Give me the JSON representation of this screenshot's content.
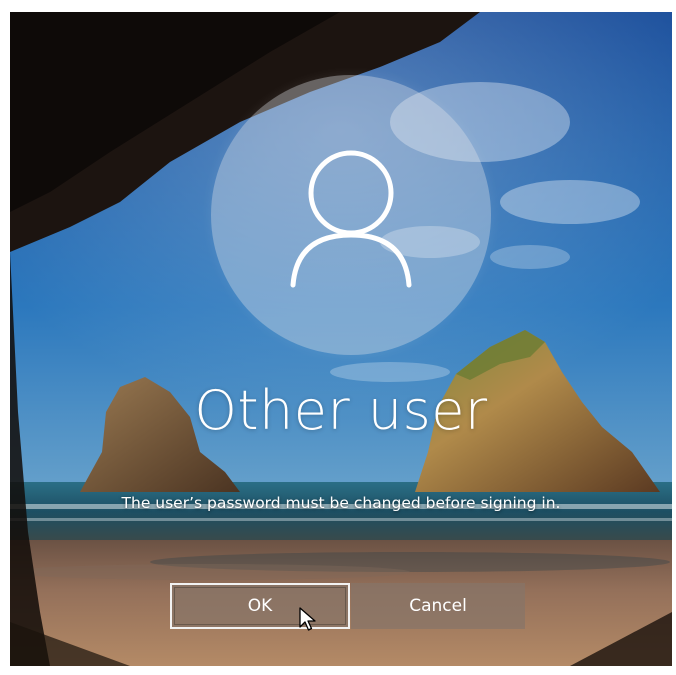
{
  "user": {
    "name": "Other user",
    "avatar_icon": "user-silhouette-icon"
  },
  "message": "The user’s password must be changed before signing in.",
  "buttons": {
    "ok": "OK",
    "cancel": "Cancel"
  },
  "cursor": {
    "icon": "mouse-pointer-icon"
  },
  "colors": {
    "button_bg": "#877468",
    "text": "#ffffff",
    "sky": "#1f5fa8",
    "sea": "#1e5b78",
    "sand": "#8e6a4e"
  }
}
